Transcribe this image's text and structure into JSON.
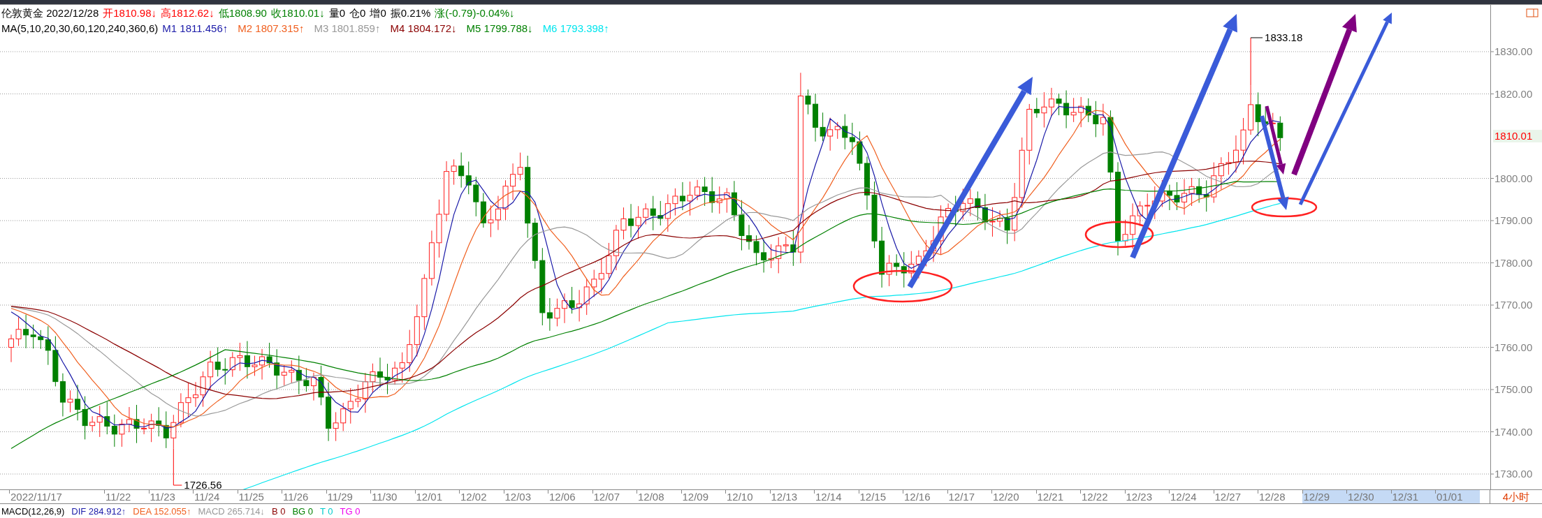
{
  "quote": {
    "items": [
      {
        "text": "伦敦黄金 2022/12/28",
        "color": "#000000"
      },
      {
        "text": "开1810.98↓",
        "color": "#ff0000"
      },
      {
        "text": "高1812.62↓",
        "color": "#ff0000"
      },
      {
        "text": "低1808.90",
        "color": "#008000"
      },
      {
        "text": "收1810.01↓",
        "color": "#008000"
      },
      {
        "text": "量0",
        "color": "#000000"
      },
      {
        "text": "仓0",
        "color": "#000000"
      },
      {
        "text": "增0",
        "color": "#000000"
      },
      {
        "text": "振0.21%",
        "color": "#000000"
      },
      {
        "text": "涨(-0.79)-0.04%↓",
        "color": "#008000"
      }
    ]
  },
  "ma": {
    "label": "MA(5,10,20,30,60,120,240,360,6)",
    "lines": [
      {
        "text": "M1 1811.456↑",
        "color": "#1a1aa8"
      },
      {
        "text": "M2 1807.315↑",
        "color": "#f06020"
      },
      {
        "text": "M3 1801.859↑",
        "color": "#999999"
      },
      {
        "text": "M4 1804.172↓",
        "color": "#8b0000"
      },
      {
        "text": "M5 1799.788↓",
        "color": "#008000"
      },
      {
        "text": "M6 1793.398↑",
        "color": "#00e5ee"
      }
    ]
  },
  "chart": {
    "price_labels": [
      "1830.00",
      "1820.00",
      "1800.00",
      "1790.00",
      "1780.00",
      "1770.00",
      "1760.00",
      "1750.00",
      "1740.00",
      "1730.00"
    ],
    "current_price": "1810.01",
    "low_label": "1726.56",
    "high_label": "1833.18"
  },
  "dates": [
    {
      "label": "2022/11/17",
      "future": false
    },
    {
      "label": "11/22",
      "future": false
    },
    {
      "label": "11/23",
      "future": false
    },
    {
      "label": "11/24",
      "future": false
    },
    {
      "label": "11/25",
      "future": false
    },
    {
      "label": "11/26",
      "future": false
    },
    {
      "label": "11/29",
      "future": false
    },
    {
      "label": "11/30",
      "future": false
    },
    {
      "label": "12/01",
      "future": false
    },
    {
      "label": "12/02",
      "future": false
    },
    {
      "label": "12/03",
      "future": false
    },
    {
      "label": "12/06",
      "future": false
    },
    {
      "label": "12/07",
      "future": false
    },
    {
      "label": "12/08",
      "future": false
    },
    {
      "label": "12/09",
      "future": false
    },
    {
      "label": "12/10",
      "future": false
    },
    {
      "label": "12/13",
      "future": false
    },
    {
      "label": "12/14",
      "future": false
    },
    {
      "label": "12/15",
      "future": false
    },
    {
      "label": "12/16",
      "future": false
    },
    {
      "label": "12/17",
      "future": false
    },
    {
      "label": "12/20",
      "future": false
    },
    {
      "label": "12/21",
      "future": false
    },
    {
      "label": "12/22",
      "future": false
    },
    {
      "label": "12/23",
      "future": false
    },
    {
      "label": "12/24",
      "future": false
    },
    {
      "label": "12/27",
      "future": false
    },
    {
      "label": "12/28",
      "future": false
    },
    {
      "label": "12/29",
      "future": true
    },
    {
      "label": "12/30",
      "future": true
    },
    {
      "label": "12/31",
      "future": true
    },
    {
      "label": "01/01",
      "future": true
    }
  ],
  "period": "4小时",
  "macd": {
    "items": [
      {
        "text": "MACD(12,26,9)",
        "color": "#000000"
      },
      {
        "text": "DIF 284.912↑",
        "color": "#1a1aa8"
      },
      {
        "text": "DEA 152.055↑",
        "color": "#f06020"
      },
      {
        "text": "MACD 265.714↓",
        "color": "#999999"
      },
      {
        "text": "B 0",
        "color": "#8b0000"
      },
      {
        "text": "BG 0",
        "color": "#008000"
      },
      {
        "text": "T 0",
        "color": "#00cccc"
      },
      {
        "text": "TG 0",
        "color": "#ee00ee"
      }
    ]
  }
}
